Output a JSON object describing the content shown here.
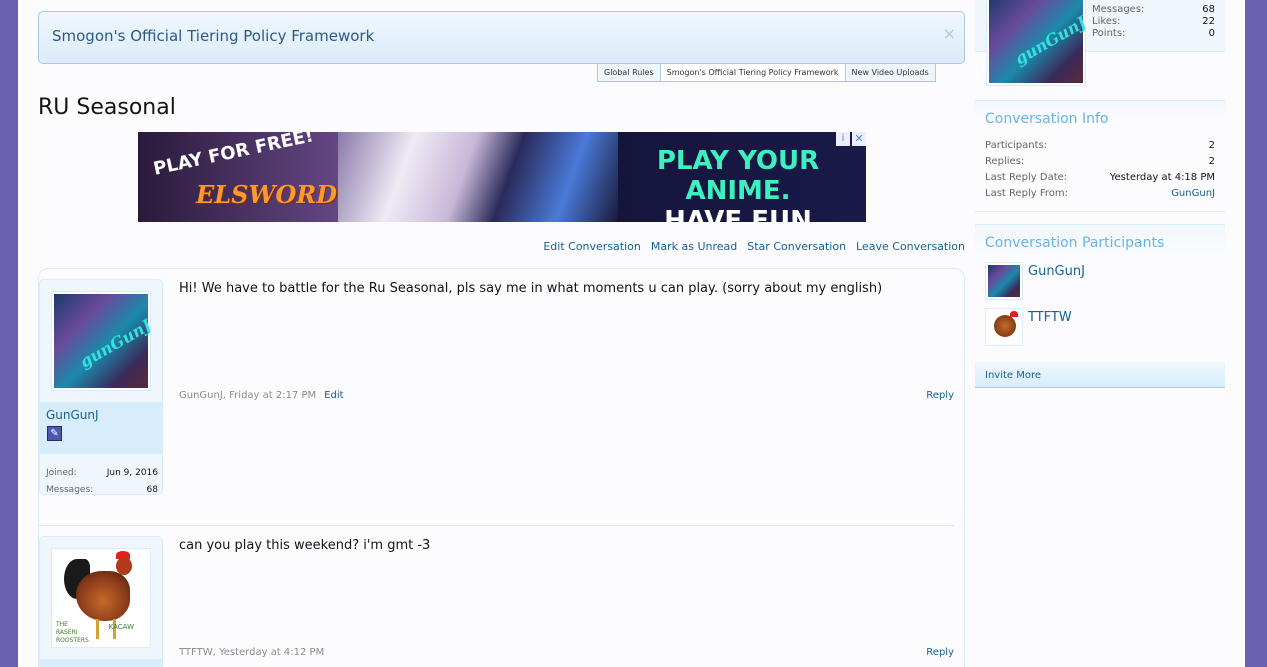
{
  "notice": {
    "title": "Smogon's Official Tiering Policy Framework",
    "close": "×",
    "tabs": [
      "Global Rules",
      "Smogon's Official Tiering Policy Framework",
      "New Video Uploads"
    ]
  },
  "page_title": "RU Seasonal",
  "ad": {
    "play_for_free": "PLAY FOR FREE!",
    "game": "ELSWORD",
    "slogan_line1": "PLAY YOUR ANIME.",
    "slogan_line2": "HAVE FUN TODAY!",
    "info": "i",
    "close": "✕"
  },
  "conversation_actions": [
    "Edit Conversation",
    "Mark as Unread",
    "Star Conversation",
    "Leave Conversation"
  ],
  "messages": [
    {
      "username": "GunGunJ",
      "avatar": "gungunj-avatar",
      "joined_label": "Joined:",
      "joined": "Jun 9, 2016",
      "messages_label": "Messages:",
      "messages": "68",
      "text": "Hi! We have to battle for the Ru Seasonal, pls say me in what moments u can play. (sorry about my english)",
      "meta": "GunGunJ, Friday at 2:17 PM",
      "edit": "Edit",
      "reply": "Reply"
    },
    {
      "username": "TTFTW",
      "avatar": "rooster-avatar",
      "text": "can you play this weekend? i'm gmt -3",
      "meta": "TTFTW, Yesterday at 4:12 PM",
      "reply": "Reply",
      "avatar_text_left": "THE\nRASERI\nROOSTERS",
      "avatar_text_right": "KACAW"
    }
  ],
  "sidebar": {
    "profile": {
      "stats": [
        {
          "label": "Messages:",
          "value": "68"
        },
        {
          "label": "Likes:",
          "value": "22"
        },
        {
          "label": "Points:",
          "value": "0"
        }
      ]
    },
    "info": {
      "title": "Conversation Info",
      "rows": [
        {
          "label": "Participants:",
          "value": "2"
        },
        {
          "label": "Replies:",
          "value": "2"
        },
        {
          "label": "Last Reply Date:",
          "value": "Yesterday at 4:18 PM"
        },
        {
          "label": "Last Reply From:",
          "value": "GunGunJ"
        }
      ]
    },
    "participants": {
      "title": "Conversation Participants",
      "list": [
        "GunGunJ",
        "TTFTW"
      ],
      "invite": "Invite More"
    }
  },
  "colors": {
    "background": "#6b5fb0",
    "link": "#176093",
    "block_title": "#6cb2e4",
    "border": "#d7edfc"
  }
}
